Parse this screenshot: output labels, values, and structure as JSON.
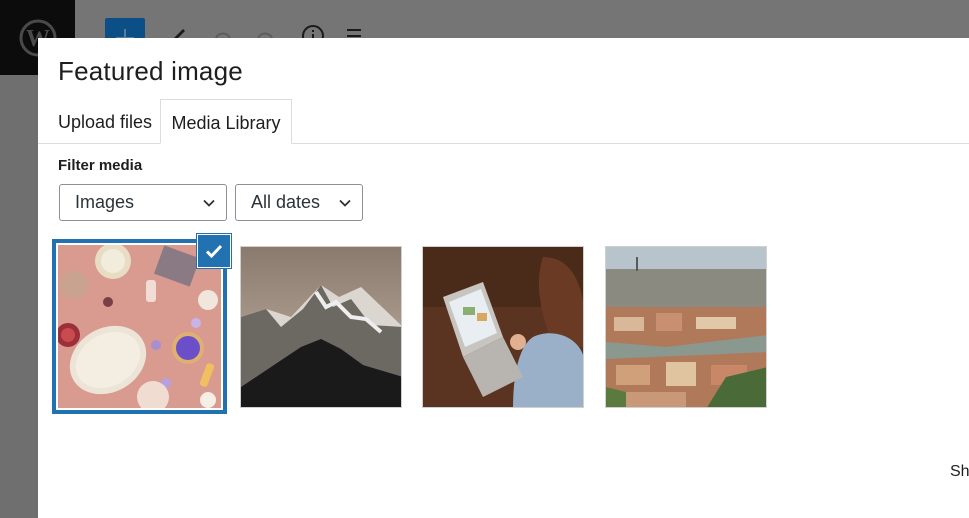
{
  "modal": {
    "title": "Featured image",
    "tabs": [
      {
        "label": "Upload files",
        "active": false
      },
      {
        "label": "Media Library",
        "active": true
      }
    ],
    "filter_label": "Filter media",
    "filters": {
      "type_selected": "Images",
      "date_selected": "All dates"
    },
    "media_items": [
      {
        "subject": "pink flat-lay with cosmetics and knit bag",
        "selected": true
      },
      {
        "subject": "snowy mountain peaks",
        "selected": false
      },
      {
        "subject": "woman using laptop",
        "selected": false
      },
      {
        "subject": "aerial city view",
        "selected": false
      }
    ],
    "partial_text": "Sh"
  },
  "colors": {
    "accent": "#2271b1",
    "overlay": "#7a7a7a",
    "wp_logo_bg": "#0c0c0c"
  },
  "icons": [
    "wordpress-logo-icon",
    "plus-icon",
    "pencil-icon",
    "undo-icon",
    "redo-icon",
    "info-icon",
    "list-view-icon",
    "chevron-down-icon",
    "checkmark-icon"
  ]
}
